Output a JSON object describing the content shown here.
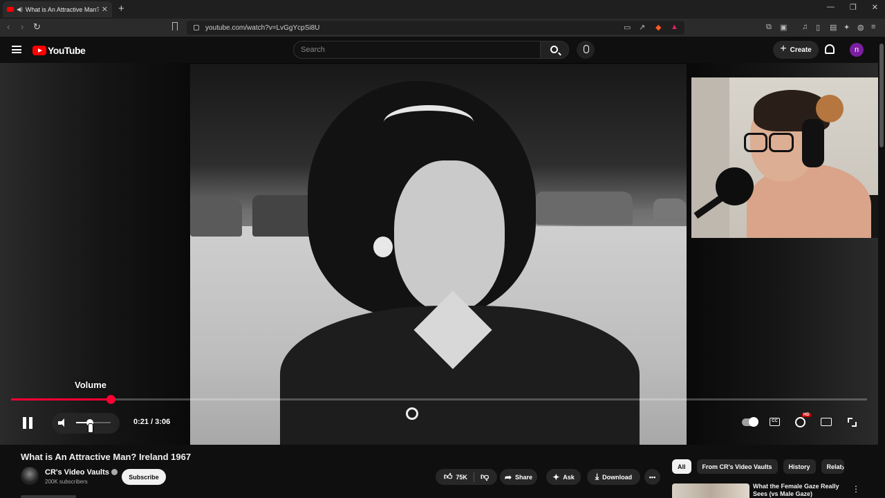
{
  "browser": {
    "tab_title": "What is An Attractive Man? Ir",
    "tab_close": "✕",
    "new_tab": "+",
    "window_controls": [
      "—",
      "❐",
      "✕"
    ],
    "url": "youtube.com/watch?v=LvGgYcpSi8U"
  },
  "header": {
    "logo_text": "YouTube",
    "search_placeholder": "Search",
    "create_label": "Create",
    "avatar_letter": "n"
  },
  "player": {
    "volume_tooltip": "Volume",
    "current_time": "0:21",
    "duration": "3:06",
    "time_display": "0:21 / 3:06",
    "progress_fraction": 0.116,
    "volume_fraction": 0.4,
    "hd_badge": "HD",
    "cc_label": "CC"
  },
  "video": {
    "title": "What is An Attractive Man? Ireland 1967",
    "channel_name": "CR's Video Vaults",
    "subscribers": "200K subscribers",
    "subscribe_label": "Subscribe",
    "likes": "75K",
    "share_label": "Share",
    "ask_label": "Ask",
    "download_label": "Download",
    "more_label": "•••"
  },
  "sidebar": {
    "chips": [
      "All",
      "From CR's Video Vaults",
      "History",
      "Relat"
    ],
    "recommendation_title": "What the Female Gaze Really Sees (vs Male Gaze)"
  },
  "colors": {
    "accent": "#ff0033",
    "background": "#0f0f0f"
  }
}
